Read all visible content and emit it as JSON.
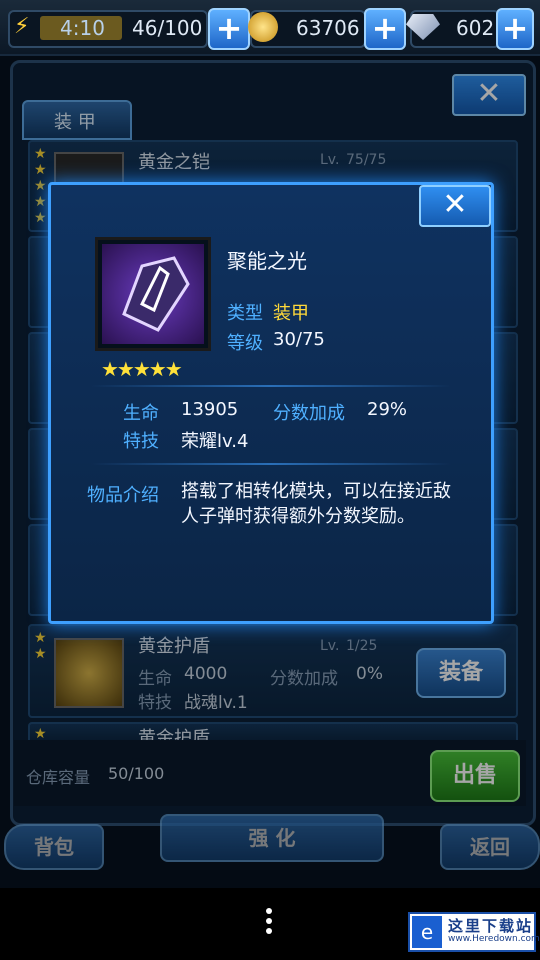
{
  "topbar": {
    "time": "4:10",
    "energy": "46/100",
    "coins": "63706",
    "gems": "602"
  },
  "panel": {
    "tabs": [
      "装 甲"
    ],
    "close_symbol": "✕",
    "items": [
      {
        "name": "黄金之铠",
        "level": "75/75",
        "stars": 5
      },
      {
        "name": "黄金护盾",
        "level": "1/25",
        "stars": 2,
        "hp_label": "生命",
        "hp": "4000",
        "bonus_label": "分数加成",
        "bonus": "0%",
        "skill_label": "特技",
        "skill": "战魂lv.1",
        "action": "装备"
      },
      {
        "name": "黄金护盾",
        "stars": 1
      }
    ],
    "storage_label": "仓库容量",
    "storage_value": "50/100",
    "sell": "出售"
  },
  "bottom_nav": {
    "backpack": "背包",
    "upgrade": "强 化",
    "back": "返回"
  },
  "popup": {
    "close_symbol": "✕",
    "item_name": "聚能之光",
    "type_label": "类型",
    "type_value": "装甲",
    "level_label": "等级",
    "level_value": "30/75",
    "stars": 5,
    "hp_label": "生命",
    "hp_value": "13905",
    "bonus_label": "分数加成",
    "bonus_value": "29%",
    "skill_label": "特技",
    "skill_value": "荣耀lv.4",
    "desc_label": "物品介绍",
    "desc_text": "搭载了相转化模块，可以在接近敌人子弹时获得额外分数奖励。"
  },
  "watermark": {
    "title": "这里下载站",
    "url": "www.Heredown.com"
  },
  "colors": {
    "label_blue": "#4fb0ff",
    "type_yellow": "#ffd93a",
    "star_yellow": "#ffd93a",
    "popup_border": "#3ea0ff"
  }
}
